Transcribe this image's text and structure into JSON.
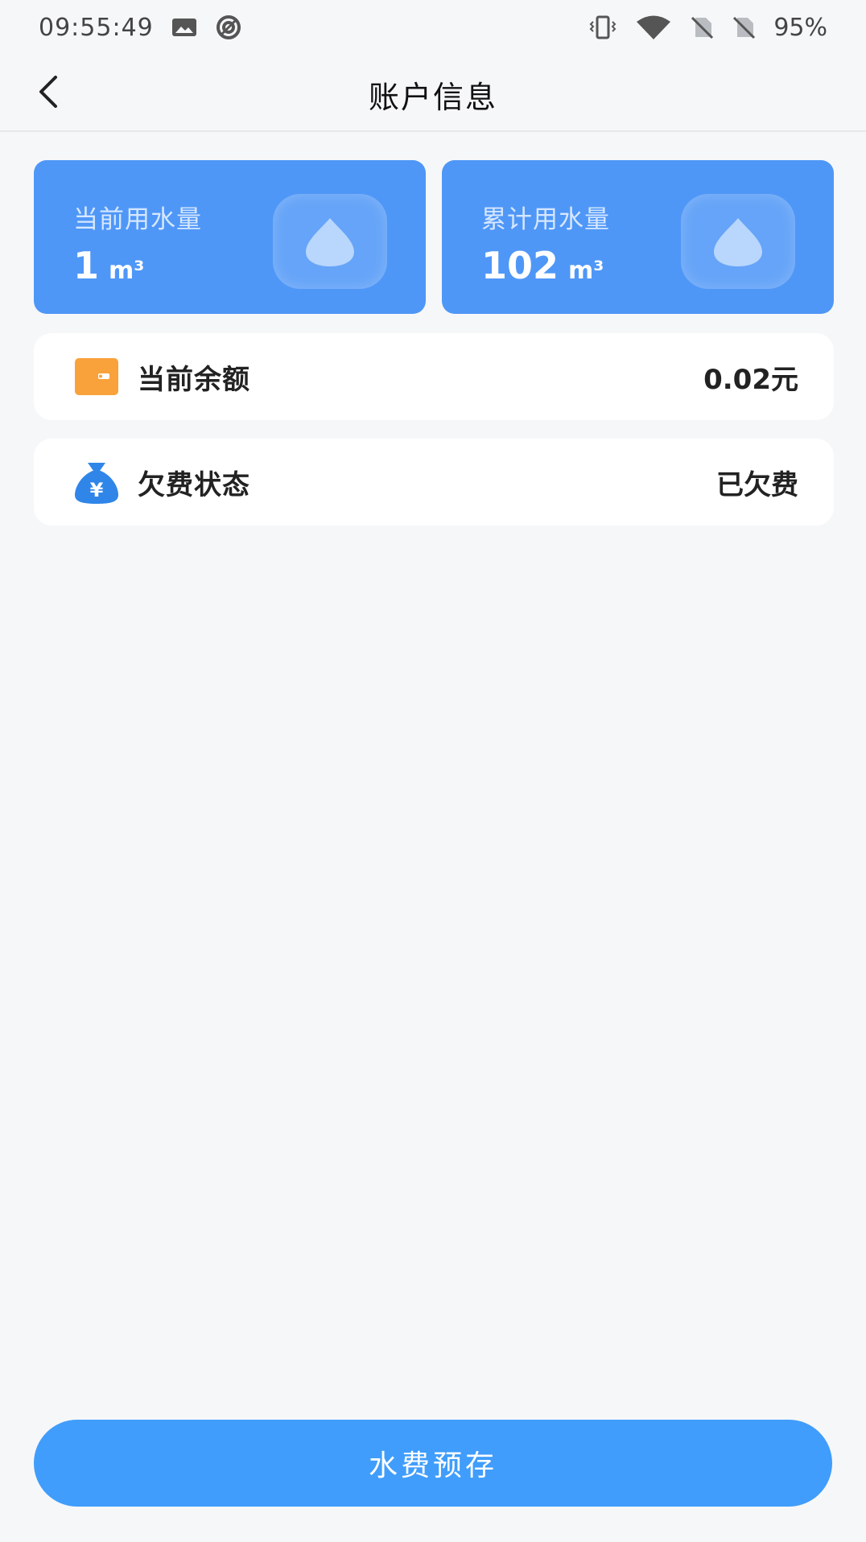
{
  "status_bar": {
    "time": "09:55:49",
    "battery": "95%",
    "icons": [
      "image-icon",
      "sync-icon",
      "vibrate-icon",
      "wifi-icon",
      "sim-off-icon",
      "sim-off-icon"
    ]
  },
  "nav": {
    "title": "账户信息",
    "back_icon": "chevron-left-icon"
  },
  "usage": {
    "current": {
      "label": "当前用水量",
      "value": "1",
      "unit": "m³",
      "icon": "water-drop-icon"
    },
    "total": {
      "label": "累计用水量",
      "value": "102",
      "unit": "m³",
      "icon": "water-drop-icon"
    }
  },
  "balance": {
    "label": "当前余额",
    "value": "0.02元",
    "icon": "wallet-icon"
  },
  "arrears": {
    "label": "欠费状态",
    "value": "已欠费",
    "icon": "money-bag-icon"
  },
  "prepay_button": {
    "label": "水费预存"
  },
  "colors": {
    "card_blue": "#4f97f7",
    "button_blue": "#409dfb",
    "wallet_orange": "#f9a23b",
    "bag_blue": "#2f86e8"
  }
}
